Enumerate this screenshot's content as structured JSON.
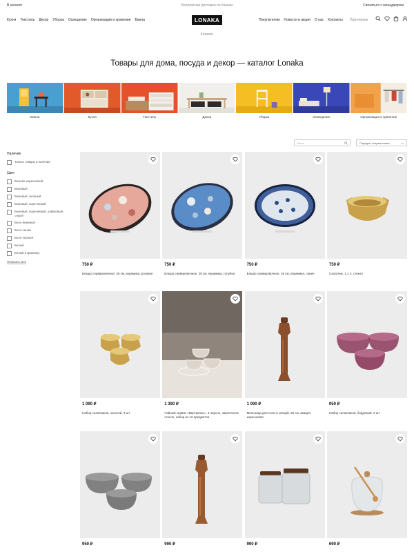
{
  "topbar": {
    "catalog_link": "В каталог",
    "delivery": "Бесплатная доставка по Казани",
    "contact_manager": "Связаться с менеджером"
  },
  "nav": {
    "left": [
      "Кухня",
      "Текстиль",
      "Декор",
      "Уборка",
      "Освещение",
      "Организация и хранение",
      "Ванна"
    ],
    "logo": "LONAKA",
    "right": [
      "Покупателям",
      "Новости и акции",
      "О нас",
      "Контакты"
    ],
    "partners": "Партнерам",
    "icons": [
      "search-icon",
      "heart-icon",
      "bag-icon",
      "user-icon"
    ]
  },
  "breadcrumb": "Каталог",
  "page_title": "Товары для дома, посуда и декор — каталог Lonaka",
  "categories": [
    {
      "label": "Ванна",
      "color": "#4a9fd1"
    },
    {
      "label": "Кухня",
      "color": "#e35a2a"
    },
    {
      "label": "Текстиль",
      "color": "#e5512b"
    },
    {
      "label": "Декор",
      "color": "#f1efec"
    },
    {
      "label": "Уборка",
      "color": "#f5bf23"
    },
    {
      "label": "Освещение",
      "color": "#3a47b8"
    },
    {
      "label": "Организация и хранение",
      "color": "#f0a34a"
    }
  ],
  "controls": {
    "search_placeholder": "Поиск",
    "sort_value": "Порядок: сперва новые"
  },
  "filters": {
    "availability_title": "Наличие",
    "availability_option": "Только товары в наличии",
    "color_title": "Цвет",
    "colors": [
      "Бежево-коричневый",
      "Бежевый",
      "Бежевый, зеленый",
      "Бежевый, коричневый",
      "Бежевый, коричневый, оливковый, серый",
      "Бело-бежевый",
      "Бело-синий",
      "Бело-черный",
      "Белый",
      "Белый в крапинку"
    ],
    "show_more": "Показать все"
  },
  "products": [
    {
      "price": "750 ₽",
      "name": "Блюдо сервировочное, 28 см, керамика, розовое"
    },
    {
      "price": "750 ₽",
      "name": "Блюдо сервировочное, 28 см, керамика, голубое"
    },
    {
      "price": "750 ₽",
      "name": "Блюдо сервировочное, 28 см, керамика, синее"
    },
    {
      "price": "750 ₽",
      "name": "Салатник, 1,1 л, стекло"
    },
    {
      "price": "1 090 ₽",
      "name": "Набор салатников, золотой, 3 шт"
    },
    {
      "price": "1 390 ₽",
      "name": "Чайный сервиз «Вертикаль», 6 персон, закаленное стекло, набор из 12 предметов"
    },
    {
      "price": "1 090 ₽",
      "name": "Мельница для соли и специй, 25 см, акация, коричневая"
    },
    {
      "price": "950 ₽",
      "name": "Набор салатников, бордовый, 3 шт"
    },
    {
      "price": "950 ₽",
      "name": ""
    },
    {
      "price": "990 ₽",
      "name": ""
    },
    {
      "price": "990 ₽",
      "name": ""
    },
    {
      "price": "690 ₽",
      "name": ""
    }
  ]
}
